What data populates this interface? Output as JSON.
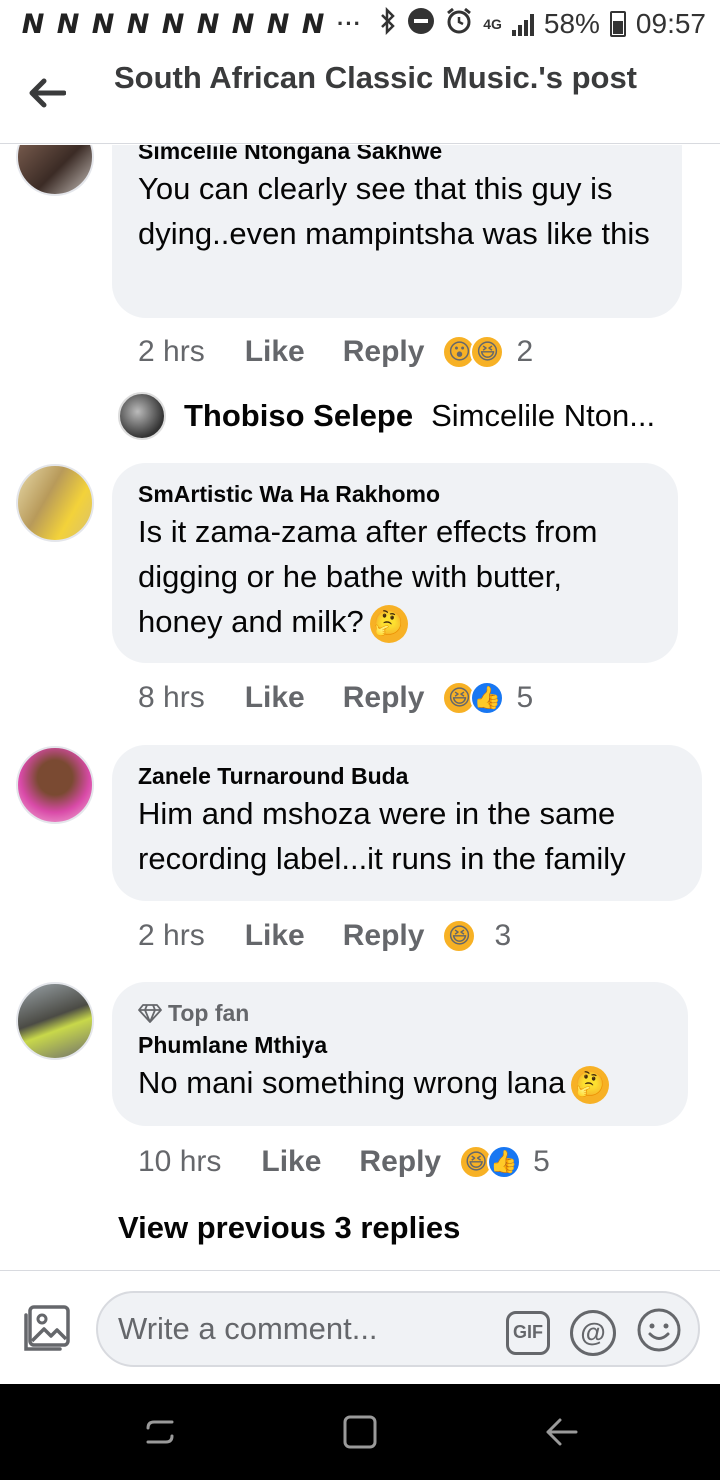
{
  "status_bar": {
    "notification_letters": [
      "N",
      "N",
      "N",
      "N",
      "N",
      "N",
      "N",
      "N",
      "N"
    ],
    "overflow": "···",
    "network": "4G",
    "battery": "58%",
    "time": "09:57"
  },
  "header": {
    "title": "South African Classic Music.'s post"
  },
  "comments": [
    {
      "author": "Simcelile Ntongana Sakhwe",
      "text": "You can clearly see that this guy is dying..even mampintsha was like this",
      "time": "2 hrs",
      "like": "Like",
      "reply": "Reply",
      "reactions": [
        "wow",
        "haha"
      ],
      "count": "2"
    },
    {
      "author": "SmArtistic Wa Ha Rakhomo",
      "text": "Is it zama-zama after effects from digging or he bathe with butter, honey and milk?",
      "time": "8 hrs",
      "like": "Like",
      "reply": "Reply",
      "reactions": [
        "haha",
        "like"
      ],
      "count": "5"
    },
    {
      "author": "Zanele Turnaround Buda",
      "text": "Him and mshoza were in the same recording label...it runs in the family",
      "time": "2 hrs",
      "like": "Like",
      "reply": "Reply",
      "reactions": [
        "haha"
      ],
      "count": "3"
    },
    {
      "badge": "Top fan",
      "author": "Phumlane Mthiya",
      "text": "No mani something wrong lana",
      "time": "10 hrs",
      "like": "Like",
      "reply": "Reply",
      "reactions": [
        "haha",
        "like"
      ],
      "count": "5"
    }
  ],
  "reply_preview": {
    "name": "Thobiso Selepe",
    "text": "Simcelile Nton..."
  },
  "view_previous": "View previous 3 replies",
  "composer": {
    "placeholder": "Write a comment...",
    "gif": "GIF",
    "at": "@"
  },
  "colors": {
    "bubble": "#f0f2f5",
    "secondary_text": "#65676b",
    "like_blue": "#1877f2",
    "emoji_yellow": "#f7b125"
  }
}
